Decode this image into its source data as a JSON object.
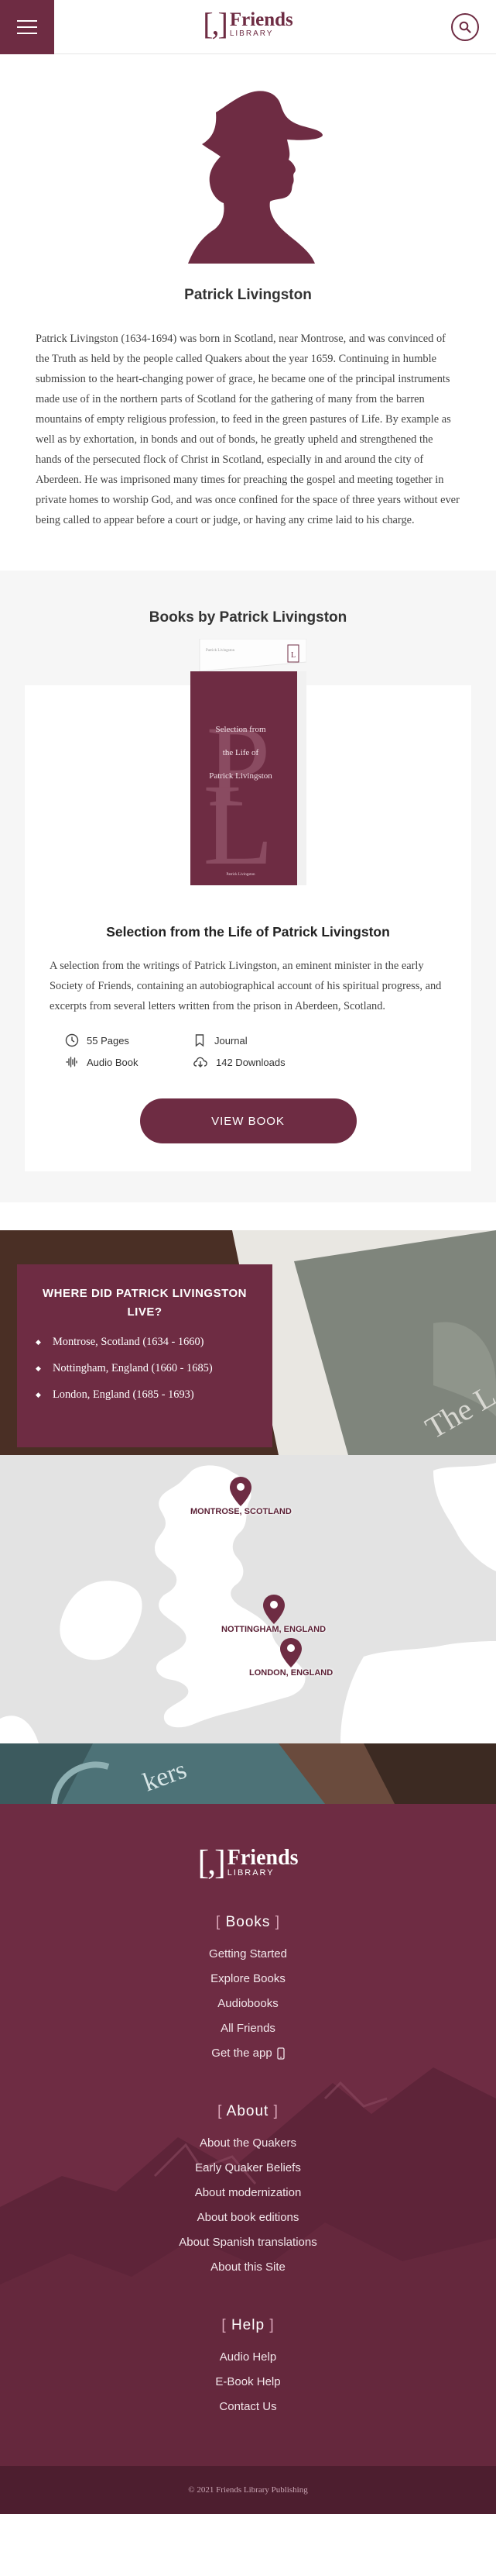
{
  "header": {
    "logo_bracket": "[,]",
    "logo_word": "Friends",
    "logo_sub": "LIBRARY"
  },
  "author": {
    "name": "Patrick Livingston",
    "bio": "Patrick Livingston (1634-1694) was born in Scotland, near Montrose, and was convinced of the Truth as held by the people called Quakers about the year 1659. Continuing in humble submission to the heart-changing power of grace, he became one of the principal instruments made use of in the northern parts of Scotland for the gathering of many from the barren mountains of empty religious profession, to feed in the green pastures of Life. By example as well as by exhortation, in bonds and out of bonds, he greatly upheld and strengthened the hands of the persecuted flock of Christ in Scotland, especially in and around the city of Aberdeen. He was imprisoned many times for preaching the gospel and meeting together in private homes to worship God, and was once confined for the space of three years without ever being called to appear before a court or judge, or having any crime laid to his charge."
  },
  "books": {
    "section_title": "Books by Patrick Livingston",
    "items": [
      {
        "cover_top": "Patrick Livingston",
        "cover_title": [
          "Selection from",
          "the Life of",
          "Patrick Livingston"
        ],
        "cover_letters": "PL",
        "cover_bottom": "Patrick Livingston",
        "title": "Selection from the Life of Patrick Livingston",
        "description": "A selection from the writings of Patrick Livingston, an eminent minister in the early Society of Friends, containing an autobiographical account of his spiritual progress, and excerpts from several letters written from the prison in Aberdeen, Scotland.",
        "pages": "55 Pages",
        "type": "Journal",
        "audio": "Audio Book",
        "downloads": "142 Downloads",
        "button": "VIEW BOOK"
      }
    ]
  },
  "lived": {
    "title": "WHERE DID PATRICK LIVINGSTON LIVE?",
    "places": [
      "Montrose, Scotland (1634 - 1660)",
      "Nottingham, England (1660 - 1685)",
      "London, England (1685 - 1693)"
    ]
  },
  "map": {
    "pins": [
      "MONTROSE, SCOTLAND",
      "NOTTINGHAM, ENGLAND",
      "LONDON, ENGLAND"
    ]
  },
  "footer": {
    "logo_bracket": "[,]",
    "logo_word": "Friends",
    "logo_sub": "LIBRARY",
    "sections": [
      {
        "heading": "Books",
        "links": [
          "Getting Started",
          "Explore Books",
          "Audiobooks",
          "All Friends",
          "Get the app"
        ]
      },
      {
        "heading": "About",
        "links": [
          "About the Quakers",
          "Early Quaker Beliefs",
          "About modernization",
          "About book editions",
          "About Spanish translations",
          "About this Site"
        ]
      },
      {
        "heading": "Help",
        "links": [
          "Audio Help",
          "E-Book Help",
          "Contact Us"
        ]
      }
    ],
    "copyright": "© 2021 Friends Library Publishing"
  },
  "colors": {
    "brand": "#6e2c43",
    "brand_dark": "#4d1e2f",
    "map_land": "#ffffff",
    "map_sea": "#e3e3e3"
  }
}
